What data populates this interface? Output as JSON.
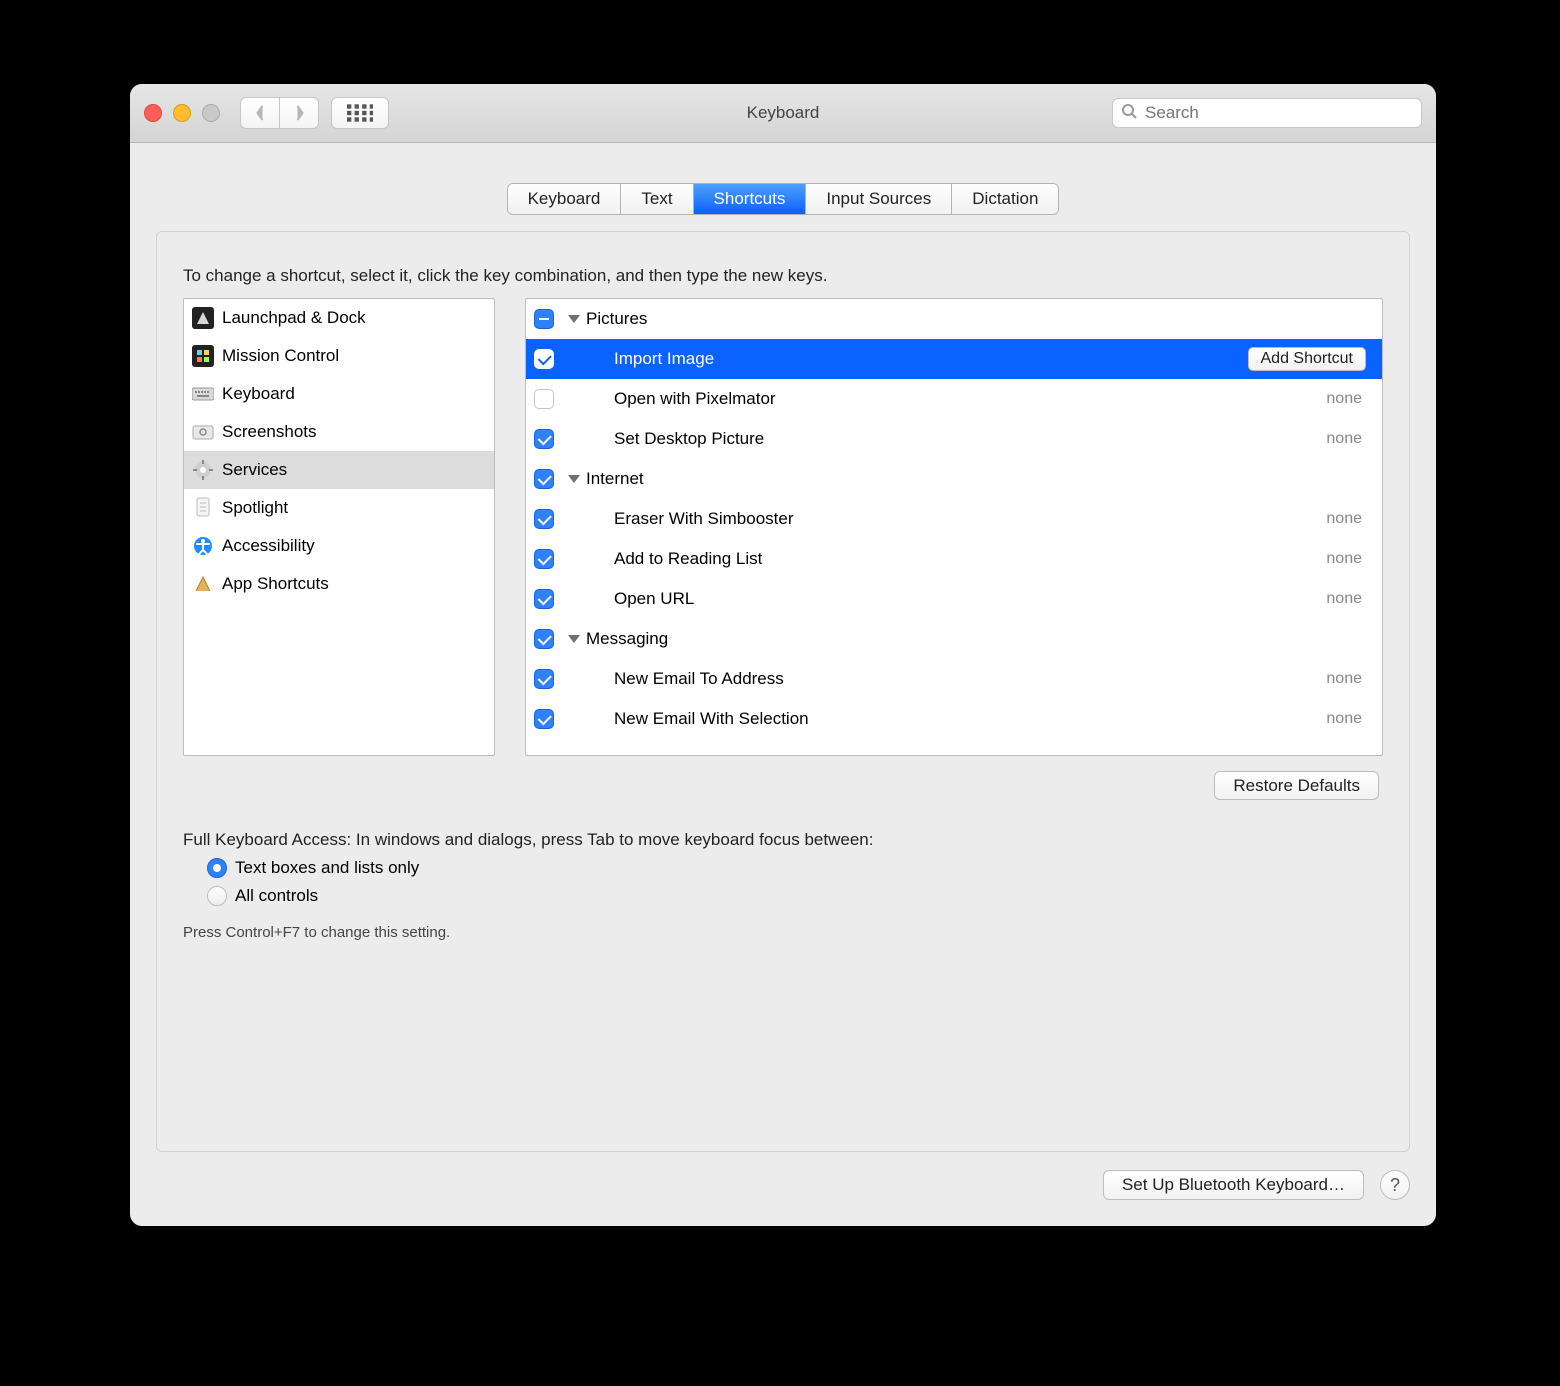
{
  "window": {
    "title": "Keyboard",
    "search_placeholder": "Search"
  },
  "tabs": [
    {
      "label": "Keyboard",
      "active": false
    },
    {
      "label": "Text",
      "active": false
    },
    {
      "label": "Shortcuts",
      "active": true
    },
    {
      "label": "Input Sources",
      "active": false
    },
    {
      "label": "Dictation",
      "active": false
    }
  ],
  "instructions": "To change a shortcut, select it, click the key combination, and then type the new keys.",
  "sidebar": {
    "items": [
      {
        "label": "Launchpad & Dock",
        "icon": "launchpad-icon"
      },
      {
        "label": "Mission Control",
        "icon": "mission-control-icon"
      },
      {
        "label": "Keyboard",
        "icon": "keyboard-icon"
      },
      {
        "label": "Screenshots",
        "icon": "screenshots-icon"
      },
      {
        "label": "Services",
        "icon": "services-icon",
        "selected": true
      },
      {
        "label": "Spotlight",
        "icon": "spotlight-icon"
      },
      {
        "label": "Accessibility",
        "icon": "accessibility-icon"
      },
      {
        "label": "App Shortcuts",
        "icon": "app-shortcuts-icon"
      }
    ]
  },
  "detail": {
    "rows": [
      {
        "type": "group",
        "label": "Pictures",
        "check": "mixed"
      },
      {
        "type": "item",
        "label": "Import Image",
        "check": "checked",
        "selected": true,
        "add_shortcut": true
      },
      {
        "type": "item",
        "label": "Open with Pixelmator",
        "check": "unchecked",
        "shortcut": "none"
      },
      {
        "type": "item",
        "label": "Set Desktop Picture",
        "check": "checked",
        "shortcut": "none"
      },
      {
        "type": "group",
        "label": "Internet",
        "check": "checked"
      },
      {
        "type": "item",
        "label": "Eraser With Simbooster",
        "check": "checked",
        "shortcut": "none"
      },
      {
        "type": "item",
        "label": "Add to Reading List",
        "check": "checked",
        "shortcut": "none"
      },
      {
        "type": "item",
        "label": "Open URL",
        "check": "checked",
        "shortcut": "none"
      },
      {
        "type": "group",
        "label": "Messaging",
        "check": "checked"
      },
      {
        "type": "item",
        "label": "New Email To Address",
        "check": "checked",
        "shortcut": "none"
      },
      {
        "type": "item",
        "label": "New Email With Selection",
        "check": "checked",
        "shortcut": "none"
      }
    ],
    "add_shortcut_label": "Add Shortcut"
  },
  "buttons": {
    "restore_defaults": "Restore Defaults",
    "setup_bluetooth": "Set Up Bluetooth Keyboard…"
  },
  "full_keyboard_access": {
    "intro": "Full Keyboard Access: In windows and dialogs, press Tab to move keyboard focus between:",
    "option_text_boxes": "Text boxes and lists only",
    "option_all_controls": "All controls",
    "selected": "text_boxes",
    "hint": "Press Control+F7 to change this setting."
  }
}
